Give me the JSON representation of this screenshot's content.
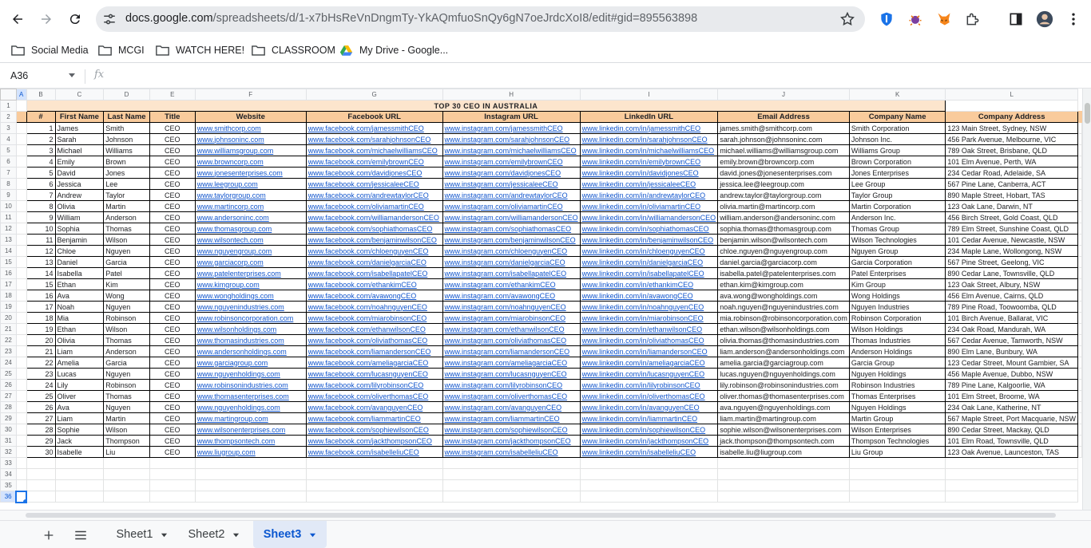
{
  "browser": {
    "url_host": "docs.google.com",
    "url_path": "/spreadsheets/d/1-x7bHsReVnDngmTy-YkAQmfuoSnQy6gN7oeJrdcXoI8/edit#gid=895563898",
    "bookmarks": [
      {
        "label": "Social Media"
      },
      {
        "label": "MCGI"
      },
      {
        "label": "WATCH HERE!"
      },
      {
        "label": "CLASSROOM"
      },
      {
        "label": "My Drive - Google..."
      }
    ]
  },
  "formula_bar": {
    "name_box": "A36",
    "fx": "fx"
  },
  "grid": {
    "columns": [
      "A",
      "B",
      "C",
      "D",
      "E",
      "F",
      "G",
      "H",
      "I",
      "J",
      "K",
      "L"
    ],
    "selected_column": "A",
    "selected_row": 36,
    "title": "TOP 30 CEO IN AUSTRALIA",
    "headers": [
      "#",
      "First Name",
      "Last Name",
      "Title",
      "Website",
      "Facebook URL",
      "Instagram URL",
      "LinkedIn URL",
      "Email Address",
      "Company Name",
      "Company Address"
    ],
    "rows": [
      [
        "1",
        "James",
        "Smith",
        "CEO",
        "www.smithcorp.com",
        "www.facebook.com/jamessmithCEO",
        "www.instagram.com/jamessmithCEO",
        "www.linkedin.com/in/jamessmithCEO",
        "james.smith@smithcorp.com",
        "Smith Corporation",
        "123 Main Street, Sydney, NSW"
      ],
      [
        "2",
        "Sarah",
        "Johnson",
        "CEO",
        "www.johnsoninc.com",
        "www.facebook.com/sarahjohnsonCEO",
        "www.instagram.com/sarahjohnsonCEO",
        "www.linkedin.com/in/sarahjohnsonCEO",
        "sarah.johnson@johnsoninc.com",
        "Johnson Inc.",
        "456 Park Avenue, Melbourne, VIC"
      ],
      [
        "3",
        "Michael",
        "Williams",
        "CEO",
        "www.williamsgroup.com",
        "www.facebook.com/michaelwilliamsCEO",
        "www.instagram.com/michaelwilliamsCEO",
        "www.linkedin.com/in/michaelwilliamsCEO",
        "michael.williams@williamsgroup.com",
        "Williams Group",
        "789 Oak Street, Brisbane, QLD"
      ],
      [
        "4",
        "Emily",
        "Brown",
        "CEO",
        "www.browncorp.com",
        "www.facebook.com/emilybrownCEO",
        "www.instagram.com/emilybrownCEO",
        "www.linkedin.com/in/emilybrownCEO",
        "emily.brown@browncorp.com",
        "Brown Corporation",
        "101 Elm Avenue, Perth, WA"
      ],
      [
        "5",
        "David",
        "Jones",
        "CEO",
        "www.jonesenterprises.com",
        "www.facebook.com/davidjonesCEO",
        "www.instagram.com/davidjonesCEO",
        "www.linkedin.com/in/davidjonesCEO",
        "david.jones@jonesenterprises.com",
        "Jones Enterprises",
        "234 Cedar Road, Adelaide, SA"
      ],
      [
        "6",
        "Jessica",
        "Lee",
        "CEO",
        "www.leegroup.com",
        "www.facebook.com/jessicaleeCEO",
        "www.instagram.com/jessicaleeCEO",
        "www.linkedin.com/in/jessicaleeCEO",
        "jessica.lee@leegroup.com",
        "Lee Group",
        "567 Pine Lane, Canberra, ACT"
      ],
      [
        "7",
        "Andrew",
        "Taylor",
        "CEO",
        "www.taylorgroup.com",
        "www.facebook.com/andrewtaylorCEO",
        "www.instagram.com/andrewtaylorCEO",
        "www.linkedin.com/in/andrewtaylorCEO",
        "andrew.taylor@taylorgroup.com",
        "Taylor Group",
        "890 Maple Street, Hobart, TAS"
      ],
      [
        "8",
        "Olivia",
        "Martin",
        "CEO",
        "www.martincorp.com",
        "www.facebook.com/oliviamartinCEO",
        "www.instagram.com/oliviamartinCEO",
        "www.linkedin.com/in/oliviamartinCEO",
        "olivia.martin@martincorp.com",
        "Martin Corporation",
        "123 Oak Lane, Darwin, NT"
      ],
      [
        "9",
        "William",
        "Anderson",
        "CEO",
        "www.andersoninc.com",
        "www.facebook.com/williamandersonCEO",
        "www.instagram.com/williamandersonCEO",
        "www.linkedin.com/in/williamandersonCEO",
        "william.anderson@andersoninc.com",
        "Anderson Inc.",
        "456 Birch Street, Gold Coast, QLD"
      ],
      [
        "10",
        "Sophia",
        "Thomas",
        "CEO",
        "www.thomasgroup.com",
        "www.facebook.com/sophiathomasCEO",
        "www.instagram.com/sophiathomasCEO",
        "www.linkedin.com/in/sophiathomasCEO",
        "sophia.thomas@thomasgroup.com",
        "Thomas Group",
        "789 Elm Street, Sunshine Coast, QLD"
      ],
      [
        "11",
        "Benjamin",
        "Wilson",
        "CEO",
        "www.wilsontech.com",
        "www.facebook.com/benjaminwilsonCEO",
        "www.instagram.com/benjaminwilsonCEO",
        "www.linkedin.com/in/benjaminwilsonCEO",
        "benjamin.wilson@wilsontech.com",
        "Wilson Technologies",
        "101 Cedar Avenue, Newcastle, NSW"
      ],
      [
        "12",
        "Chloe",
        "Nguyen",
        "CEO",
        "www.nguyengroup.com",
        "www.facebook.com/chloenguyenCEO",
        "www.instagram.com/chloenguyenCEO",
        "www.linkedin.com/in/chloenguyenCEO",
        "chloe.nguyen@nguyengroup.com",
        "Nguyen Group",
        "234 Maple Lane, Wollongong, NSW"
      ],
      [
        "13",
        "Daniel",
        "Garcia",
        "CEO",
        "www.garciacorp.com",
        "www.facebook.com/danielgarciaCEO",
        "www.instagram.com/danielgarciaCEO",
        "www.linkedin.com/in/danielgarciaCEO",
        "daniel.garcia@garciacorp.com",
        "Garcia Corporation",
        "567 Pine Street, Geelong, VIC"
      ],
      [
        "14",
        "Isabella",
        "Patel",
        "CEO",
        "www.patelenterprises.com",
        "www.facebook.com/isabellapatelCEO",
        "www.instagram.com/isabellapatelCEO",
        "www.linkedin.com/in/isabellapatelCEO",
        "isabella.patel@patelenterprises.com",
        "Patel Enterprises",
        "890 Cedar Lane, Townsville, QLD"
      ],
      [
        "15",
        "Ethan",
        "Kim",
        "CEO",
        "www.kimgroup.com",
        "www.facebook.com/ethankimCEO",
        "www.instagram.com/ethankimCEO",
        "www.linkedin.com/in/ethankimCEO",
        "ethan.kim@kimgroup.com",
        "Kim Group",
        "123 Oak Street, Albury, NSW"
      ],
      [
        "16",
        "Ava",
        "Wong",
        "CEO",
        "www.wongholdings.com",
        "www.facebook.com/avawongCEO",
        "www.instagram.com/avawongCEO",
        "www.linkedin.com/in/avawongCEO",
        "ava.wong@wongholdings.com",
        "Wong Holdings",
        "456 Elm Avenue, Cairns, QLD"
      ],
      [
        "17",
        "Noah",
        "Nguyen",
        "CEO",
        "www.nguyenindustries.com",
        "www.facebook.com/noahnguyenCEO",
        "www.instagram.com/noahnguyenCEO",
        "www.linkedin.com/in/noahnguyenCEO",
        "noah.nguyen@nguyenindustries.com",
        "Nguyen Industries",
        "789 Pine Road, Toowoomba, QLD"
      ],
      [
        "18",
        "Mia",
        "Robinson",
        "CEO",
        "www.robinsoncorporation.com",
        "www.facebook.com/miarobinsonCEO",
        "www.instagram.com/miarobinsonCEO",
        "www.linkedin.com/in/miarobinsonCEO",
        "mia.robinson@robinsoncorporation.com",
        "Robinson Corporation",
        "101 Birch Avenue, Ballarat, VIC"
      ],
      [
        "19",
        "Ethan",
        "Wilson",
        "CEO",
        "www.wilsonholdings.com",
        "www.facebook.com/ethanwilsonCEO",
        "www.instagram.com/ethanwilsonCEO",
        "www.linkedin.com/in/ethanwilsonCEO",
        "ethan.wilson@wilsonholdings.com",
        "Wilson Holdings",
        "234 Oak Road, Mandurah, WA"
      ],
      [
        "20",
        "Olivia",
        "Thomas",
        "CEO",
        "www.thomasindustries.com",
        "www.facebook.com/oliviathomasCEO",
        "www.instagram.com/oliviathomasCEO",
        "www.linkedin.com/in/oliviathomasCEO",
        "olivia.thomas@thomasindustries.com",
        "Thomas Industries",
        "567 Cedar Avenue, Tamworth, NSW"
      ],
      [
        "21",
        "Liam",
        "Anderson",
        "CEO",
        "www.andersonholdings.com",
        "www.facebook.com/liamandersonCEO",
        "www.instagram.com/liamandersonCEO",
        "www.linkedin.com/in/liamandersonCEO",
        "liam.anderson@andersonholdings.com",
        "Anderson Holdings",
        "890 Elm Lane, Bunbury, WA"
      ],
      [
        "22",
        "Amelia",
        "Garcia",
        "CEO",
        "www.garciagroup.com",
        "www.facebook.com/ameliagarciaCEO",
        "www.instagram.com/ameliagarciaCEO",
        "www.linkedin.com/in/ameliagarciaCEO",
        "amelia.garcia@garciagroup.com",
        "Garcia Group",
        "123 Cedar Street, Mount Gambier, SA"
      ],
      [
        "23",
        "Lucas",
        "Nguyen",
        "CEO",
        "www.nguyenholdings.com",
        "www.facebook.com/lucasnguyenCEO",
        "www.instagram.com/lucasnguyenCEO",
        "www.linkedin.com/in/lucasnguyenCEO",
        "lucas.nguyen@nguyenholdings.com",
        "Nguyen Holdings",
        "456 Maple Avenue, Dubbo, NSW"
      ],
      [
        "24",
        "Lily",
        "Robinson",
        "CEO",
        "www.robinsonindustries.com",
        "www.facebook.com/lilyrobinsonCEO",
        "www.instagram.com/lilyrobinsonCEO",
        "www.linkedin.com/in/lilyrobinsonCEO",
        "lily.robinson@robinsonindustries.com",
        "Robinson Industries",
        "789 Pine Lane, Kalgoorlie, WA"
      ],
      [
        "25",
        "Oliver",
        "Thomas",
        "CEO",
        "www.thomasenterprises.com",
        "www.facebook.com/oliverthomasCEO",
        "www.instagram.com/oliverthomasCEO",
        "www.linkedin.com/in/oliverthomasCEO",
        "oliver.thomas@thomasenterprises.com",
        "Thomas Enterprises",
        "101 Elm Street, Broome, WA"
      ],
      [
        "26",
        "Ava",
        "Nguyen",
        "CEO",
        "www.nguyenholdings.com",
        "www.facebook.com/avanguyenCEO",
        "www.instagram.com/avanguyenCEO",
        "www.linkedin.com/in/avanguyenCEO",
        "ava.nguyen@nguyenholdings.com",
        "Nguyen Holdings",
        "234 Oak Lane, Katherine, NT"
      ],
      [
        "27",
        "Liam",
        "Martin",
        "CEO",
        "www.martingroup.com",
        "www.facebook.com/liammartinCEO",
        "www.instagram.com/liammartinCEO",
        "www.linkedin.com/in/liammartinCEO",
        "liam.martin@martingroup.com",
        "Martin Group",
        "567 Maple Street, Port Macquarie, NSW"
      ],
      [
        "28",
        "Sophie",
        "Wilson",
        "CEO",
        "www.wilsonenterprises.com",
        "www.facebook.com/sophiewilsonCEO",
        "www.instagram.com/sophiewilsonCEO",
        "www.linkedin.com/in/sophiewilsonCEO",
        "sophie.wilson@wilsonenterprises.com",
        "Wilson Enterprises",
        "890 Cedar Street, Mackay, QLD"
      ],
      [
        "29",
        "Jack",
        "Thompson",
        "CEO",
        "www.thompsontech.com",
        "www.facebook.com/jackthompsonCEO",
        "www.instagram.com/jackthompsonCEO",
        "www.linkedin.com/in/jackthompsonCEO",
        "jack.thompson@thompsontech.com",
        "Thompson Technologies",
        "101 Elm Road, Townsville, QLD"
      ],
      [
        "30",
        "Isabelle",
        "Liu",
        "CEO",
        "www.liugroup.com",
        "www.facebook.com/isabelleliuCEO",
        "www.instagram.com/isabelleliuCEO",
        "www.linkedin.com/in/isabelleliuCEO",
        "isabelle.liu@liugroup.com",
        "Liu Group",
        "123 Oak Avenue, Launceston, TAS"
      ]
    ]
  },
  "tabs": [
    {
      "label": "Sheet1",
      "active": false
    },
    {
      "label": "Sheet2",
      "active": false
    },
    {
      "label": "Sheet3",
      "active": true
    }
  ],
  "colors": {
    "title_bg": "#fce5cd",
    "header_bg": "#f9cb9c",
    "link": "#1155cc",
    "selection": "#1a73e8"
  }
}
